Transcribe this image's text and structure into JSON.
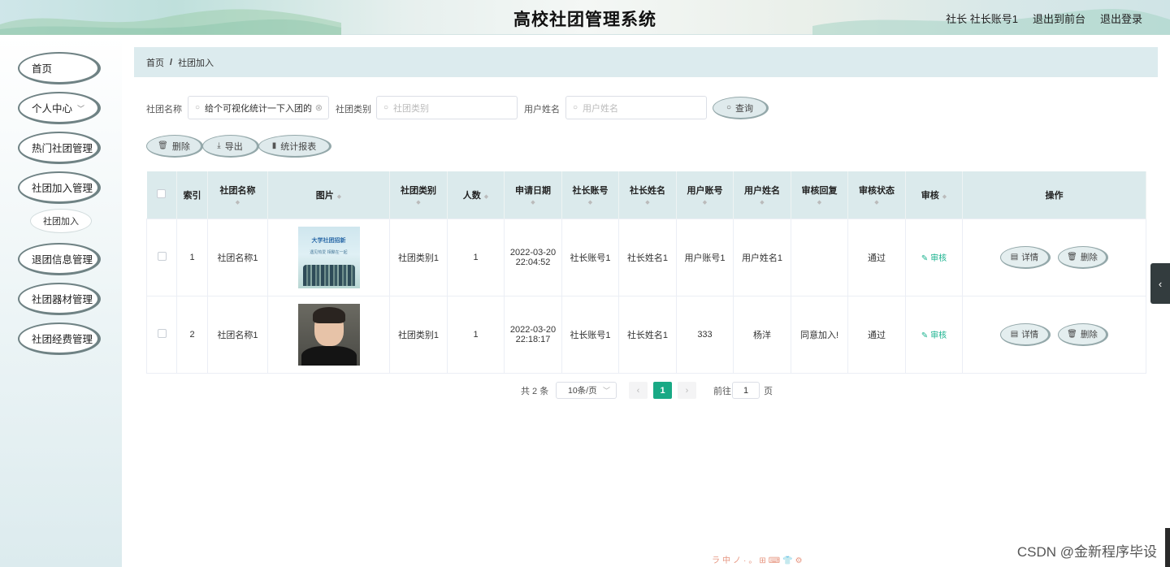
{
  "header": {
    "title": "高校社团管理系统",
    "user_label": "社长 社长账号1",
    "back_front": "退出到前台",
    "logout": "退出登录"
  },
  "sidebar": {
    "items": [
      {
        "label": "首页"
      },
      {
        "label": "个人中心"
      },
      {
        "label": "热门社团管理"
      },
      {
        "label": "社团加入管理"
      },
      {
        "label": "退团信息管理"
      },
      {
        "label": "社团器材管理"
      },
      {
        "label": "社团经费管理"
      }
    ],
    "sub_item": "社团加入"
  },
  "breadcrumb": {
    "home": "首页",
    "sep": "/",
    "current": "社团加入"
  },
  "search": {
    "club_name_label": "社团名称",
    "club_name_value": "给个可视化统计一下入团的",
    "club_type_label": "社团类别",
    "club_type_placeholder": "社团类别",
    "user_name_label": "用户姓名",
    "user_name_placeholder": "用户姓名",
    "query_button": "查询"
  },
  "actions": {
    "delete": "删除",
    "export": "导出",
    "report": "统计报表"
  },
  "table": {
    "headers": {
      "index": "索引",
      "club_name": "社团名称",
      "image": "图片",
      "club_type": "社团类别",
      "count": "人数",
      "apply_date": "申请日期",
      "leader_account": "社长账号",
      "leader_name": "社长姓名",
      "user_account": "用户账号",
      "user_name": "用户姓名",
      "review_reply": "审核回复",
      "review_status": "审核状态",
      "review": "审核",
      "operation": "操作"
    },
    "rows": [
      {
        "index": "1",
        "club_name": "社团名称1",
        "club_type": "社团类别1",
        "count": "1",
        "apply_date": "2022-03-20 22:04:52",
        "leader_account": "社长账号1",
        "leader_name": "社长姓名1",
        "user_account": "用户账号1",
        "user_name": "用户姓名1",
        "review_reply": "",
        "review_status": "通过",
        "review_link": "审核",
        "detail": "详情",
        "delete": "删除",
        "image_title": "大学社团招新",
        "image_subtitle": "遇见热爱 相聚在一起"
      },
      {
        "index": "2",
        "club_name": "社团名称1",
        "club_type": "社团类别1",
        "count": "1",
        "apply_date": "2022-03-20 22:18:17",
        "leader_account": "社长账号1",
        "leader_name": "社长姓名1",
        "user_account": "333",
        "user_name": "杨洋",
        "review_reply": "同意加入!",
        "review_status": "通过",
        "review_link": "审核",
        "detail": "详情",
        "delete": "删除"
      }
    ]
  },
  "pagination": {
    "total": "共 2 条",
    "page_size": "10条/页",
    "current_page": "1",
    "goto_label": "前往",
    "goto_value": "1",
    "page_unit": "页"
  },
  "watermark": "CSDN @金新程序毕设",
  "ime_bar": "ラ中ノ·。⊞⌨👕⚙"
}
